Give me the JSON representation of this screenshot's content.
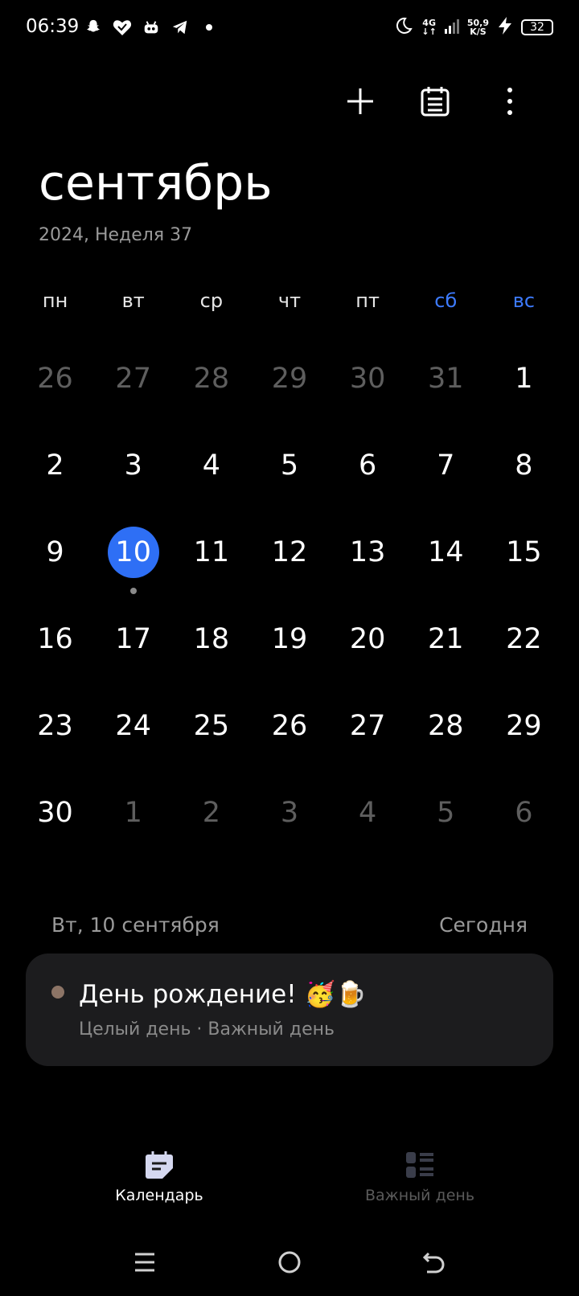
{
  "status": {
    "time": "06:39",
    "net_type": "4G",
    "net_speed": "50,9",
    "net_unit": "K/S",
    "battery": "32"
  },
  "calendar": {
    "month": "сентябрь",
    "subtitle": "2024, Неделя 37",
    "weekdays": [
      {
        "label": "пн",
        "weekend": false
      },
      {
        "label": "вт",
        "weekend": false
      },
      {
        "label": "ср",
        "weekend": false
      },
      {
        "label": "чт",
        "weekend": false
      },
      {
        "label": "пт",
        "weekend": false
      },
      {
        "label": "сб",
        "weekend": true
      },
      {
        "label": "вс",
        "weekend": true
      }
    ],
    "weeks": [
      [
        {
          "n": "26",
          "other": true
        },
        {
          "n": "27",
          "other": true
        },
        {
          "n": "28",
          "other": true
        },
        {
          "n": "29",
          "other": true
        },
        {
          "n": "30",
          "other": true
        },
        {
          "n": "31",
          "other": true
        },
        {
          "n": "1"
        }
      ],
      [
        {
          "n": "2"
        },
        {
          "n": "3"
        },
        {
          "n": "4"
        },
        {
          "n": "5"
        },
        {
          "n": "6"
        },
        {
          "n": "7"
        },
        {
          "n": "8"
        }
      ],
      [
        {
          "n": "9"
        },
        {
          "n": "10",
          "today": true,
          "event": true
        },
        {
          "n": "11"
        },
        {
          "n": "12"
        },
        {
          "n": "13"
        },
        {
          "n": "14"
        },
        {
          "n": "15"
        }
      ],
      [
        {
          "n": "16"
        },
        {
          "n": "17"
        },
        {
          "n": "18"
        },
        {
          "n": "19"
        },
        {
          "n": "20"
        },
        {
          "n": "21"
        },
        {
          "n": "22"
        }
      ],
      [
        {
          "n": "23"
        },
        {
          "n": "24"
        },
        {
          "n": "25"
        },
        {
          "n": "26"
        },
        {
          "n": "27"
        },
        {
          "n": "28"
        },
        {
          "n": "29"
        }
      ],
      [
        {
          "n": "30"
        },
        {
          "n": "1",
          "other": true
        },
        {
          "n": "2",
          "other": true
        },
        {
          "n": "3",
          "other": true
        },
        {
          "n": "4",
          "other": true
        },
        {
          "n": "5",
          "other": true
        },
        {
          "n": "6",
          "other": true
        }
      ]
    ],
    "today_color": "#2e6ff5",
    "weekend_color": "#3d7bff"
  },
  "selected_day": {
    "label": "Вт, 10 сентября",
    "today_link": "Сегодня"
  },
  "event": {
    "title": "День рождение! 🥳🍺",
    "subtitle": "Целый день · Важный день",
    "color": "#8c7466"
  },
  "bottom_nav": {
    "calendar": "Календарь",
    "important_day": "Важный день"
  }
}
